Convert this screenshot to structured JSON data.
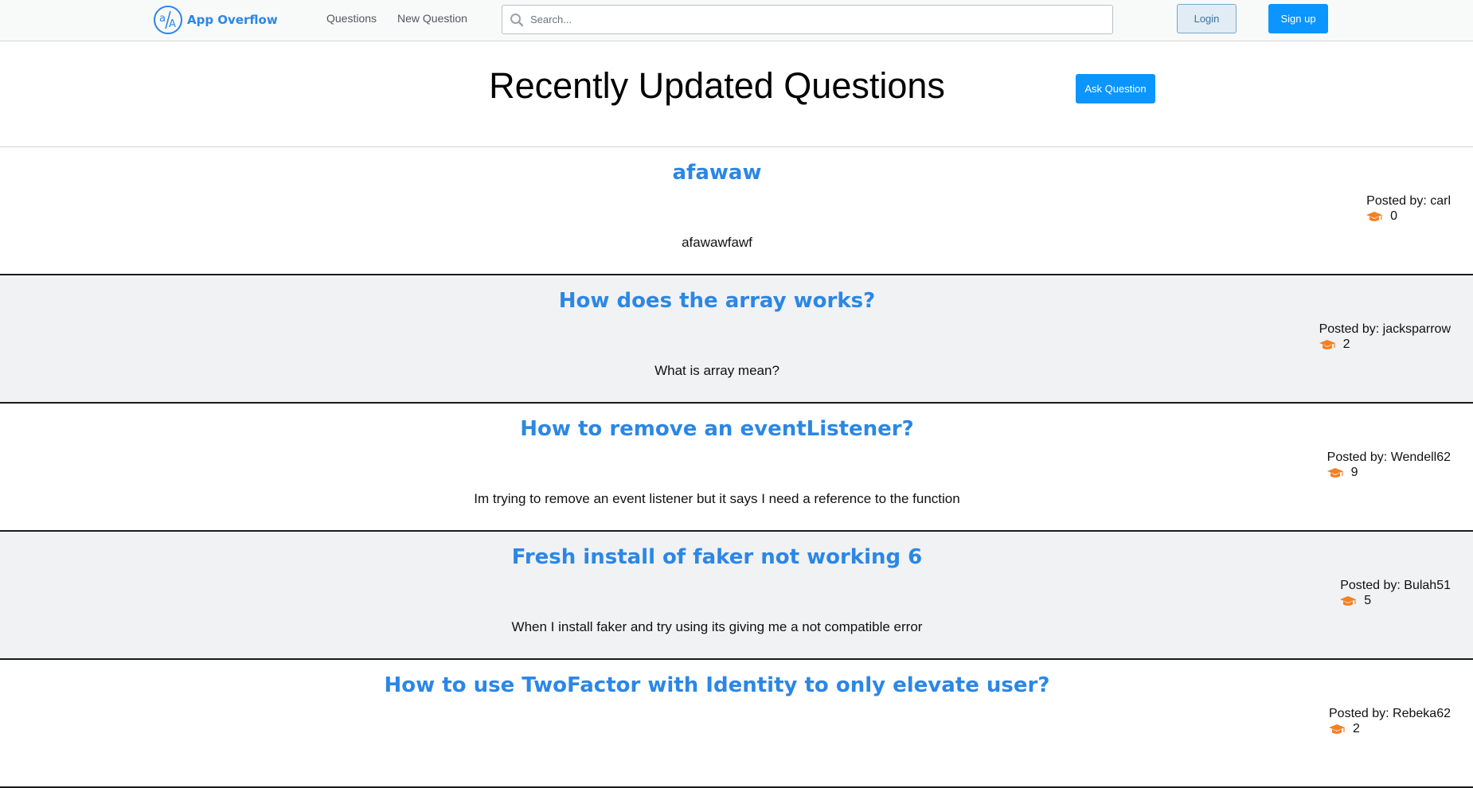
{
  "app": {
    "name": "App Overflow",
    "logo_text": "a/A"
  },
  "nav": {
    "items": [
      {
        "label": "Questions"
      },
      {
        "label": "New Question"
      }
    ]
  },
  "search": {
    "placeholder": "Search...",
    "value": ""
  },
  "auth": {
    "login_label": "Login",
    "signup_label": "Sign up"
  },
  "header": {
    "title": "Recently Updated Questions",
    "ask_label": "Ask Question"
  },
  "posted_by_prefix": "Posted by: ",
  "questions": [
    {
      "title": "afawaw",
      "body": "afawawfawf",
      "author": "carl",
      "reputation": "0"
    },
    {
      "title": "How does the array works?",
      "body": "What is array mean?",
      "author": "jacksparrow",
      "reputation": "2"
    },
    {
      "title": "How to remove an eventListener?",
      "body": "Im trying to remove an event listener but it says I need a reference to the function",
      "author": "Wendell62",
      "reputation": "9"
    },
    {
      "title": "Fresh install of faker not working 6",
      "body": "When I install faker and try using its giving me a not compatible error",
      "author": "Bulah51",
      "reputation": "5"
    },
    {
      "title": "How to use TwoFactor with Identity to only elevate user?",
      "body": "",
      "author": "Rebeka62",
      "reputation": "2"
    }
  ],
  "icons": {
    "logo": "app-logo-icon",
    "search": "search-icon",
    "reputation": "graduation-cap-icon"
  },
  "colors": {
    "brand": "#2b87e6",
    "primary_button": "#0a95ff",
    "login_button_bg": "#e1ecf4",
    "reputation_icon": "#f48024",
    "alt_row_bg": "#f1f2f3"
  }
}
